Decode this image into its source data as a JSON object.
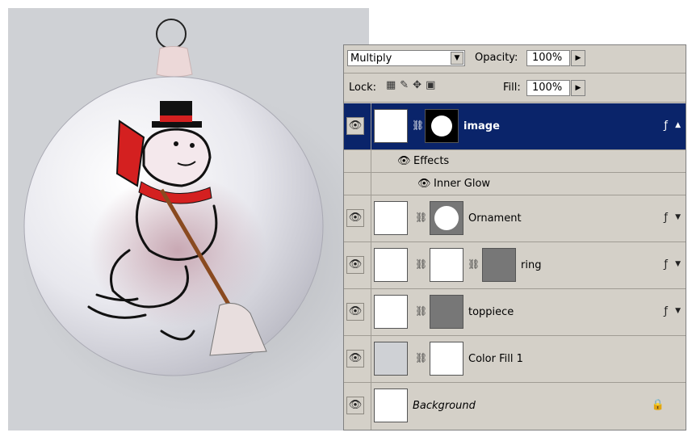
{
  "panel": {
    "blend_mode": "Multiply",
    "opacity_label": "Opacity:",
    "opacity_value": "100%",
    "lock_label": "Lock:",
    "fill_label": "Fill:",
    "fill_value": "100%"
  },
  "layers": [
    {
      "name": "image",
      "selected": true,
      "effects_label": "Effects",
      "effect": "Inner Glow"
    },
    {
      "name": "Ornament"
    },
    {
      "name": "ring"
    },
    {
      "name": "toppiece"
    },
    {
      "name": "Color Fill 1"
    },
    {
      "name": "Background"
    }
  ],
  "colors": {
    "canvas_bg": "#cfd1d5",
    "panel_bg": "#d4d0c8",
    "selected_row": "#0a246a",
    "scarf_red": "#d42020"
  }
}
